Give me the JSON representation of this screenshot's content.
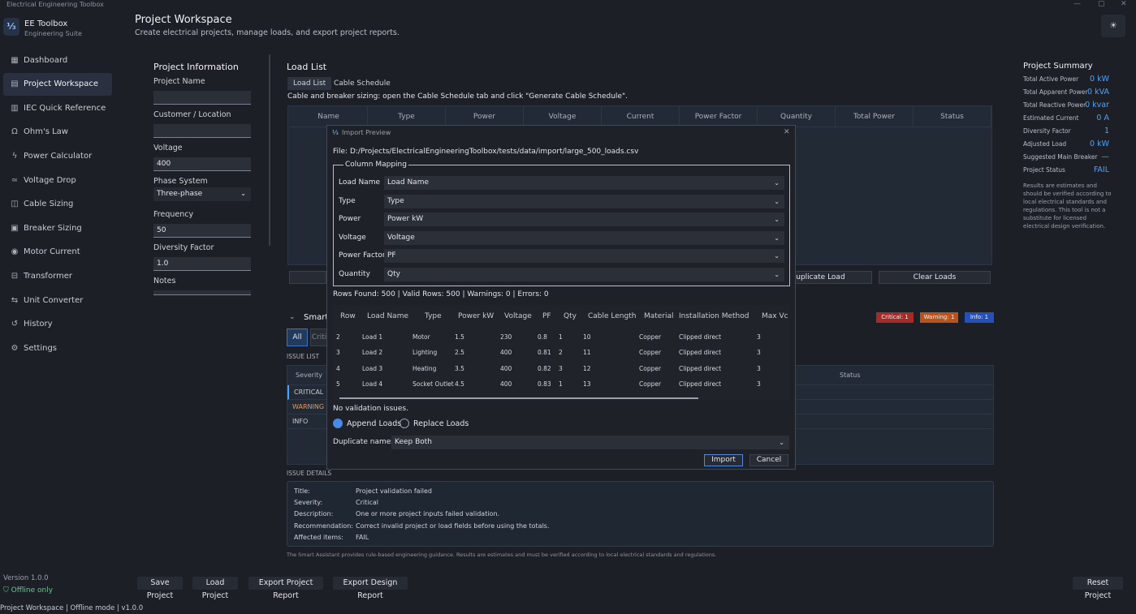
{
  "window": {
    "title": "Electrical Engineering Toolbox"
  },
  "app": {
    "logo": "⅓",
    "name": "EE Toolbox",
    "subtitle": "Engineering Suite",
    "version": "Version 1.0.0",
    "offline": "Offline only"
  },
  "nav": [
    {
      "icon": "dashboard-icon",
      "glyph": "▦",
      "label": "Dashboard"
    },
    {
      "icon": "project-icon",
      "glyph": "▤",
      "label": "Project Workspace",
      "active": true
    },
    {
      "icon": "book-icon",
      "glyph": "▥",
      "label": "IEC Quick Reference"
    },
    {
      "icon": "ohm-icon",
      "glyph": "Ω",
      "label": "Ohm's Law"
    },
    {
      "icon": "bolt-icon",
      "glyph": "ϟ",
      "label": "Power Calculator"
    },
    {
      "icon": "drop-icon",
      "glyph": "≃",
      "label": "Voltage Drop"
    },
    {
      "icon": "cable-icon",
      "glyph": "◫",
      "label": "Cable Sizing"
    },
    {
      "icon": "breaker-icon",
      "glyph": "▣",
      "label": "Breaker Sizing"
    },
    {
      "icon": "motor-icon",
      "glyph": "◉",
      "label": "Motor Current"
    },
    {
      "icon": "transformer-icon",
      "glyph": "⊟",
      "label": "Transformer"
    },
    {
      "icon": "convert-icon",
      "glyph": "⇆",
      "label": "Unit Converter"
    },
    {
      "icon": "history-icon",
      "glyph": "↺",
      "label": "History"
    },
    {
      "icon": "gear-icon",
      "glyph": "⚙",
      "label": "Settings"
    }
  ],
  "header": {
    "title": "Project Workspace",
    "subtitle": "Create electrical projects, manage loads, and export project reports."
  },
  "project_info": {
    "title": "Project Information",
    "fields": [
      {
        "label": "Project Name",
        "value": ""
      },
      {
        "label": "Customer / Location",
        "value": ""
      },
      {
        "label": "Voltage",
        "value": "400"
      },
      {
        "label": "Phase System",
        "value": "Three-phase"
      },
      {
        "label": "Frequency",
        "value": "50"
      },
      {
        "label": "Diversity Factor",
        "value": "1.0"
      },
      {
        "label": "Notes",
        "value": ""
      }
    ]
  },
  "load_list": {
    "title": "Load List",
    "tabs": [
      "Load List",
      "Cable Schedule"
    ],
    "hint": "Cable and breaker sizing: open the Cable Schedule tab and click \"Generate Cable Schedule\".",
    "columns": [
      "Name",
      "Type",
      "Power",
      "Voltage",
      "Current",
      "Power Factor",
      "Quantity",
      "Total Power",
      "Status"
    ],
    "buttons": {
      "duplicate": "Duplicate Load",
      "clear": "Clear Loads"
    }
  },
  "smart": {
    "title": "Smart",
    "filter_all": "All",
    "filter_crit": "Criti",
    "badges": {
      "critical": "Critical: 1",
      "warning": "Warning: 1",
      "info": "Info: 1"
    },
    "issue_list_title": "ISSUE LIST",
    "columns": {
      "severity": "Severity",
      "status": "Status"
    },
    "rows": [
      "CRITICAL",
      "WARNING",
      "INFO"
    ],
    "details_title": "ISSUE DETAILS",
    "details": [
      {
        "label": "Title:",
        "value": "Project validation failed"
      },
      {
        "label": "Severity:",
        "value": "Critical"
      },
      {
        "label": "Description:",
        "value": "One or more project inputs failed validation."
      },
      {
        "label": "Recommendation:",
        "value": "Correct invalid project or load fields before using the totals."
      },
      {
        "label": "Affected items:",
        "value": "FAIL"
      }
    ],
    "disclaimer": "The Smart Assistant provides rule-based engineering guidance. Results are estimates and must be verified according to local electrical standards and regulations."
  },
  "summary": {
    "title": "Project Summary",
    "items": [
      {
        "label": "Total Active Power",
        "value": "0 kW"
      },
      {
        "label": "Total Apparent Power",
        "value": "0 kVA"
      },
      {
        "label": "Total Reactive Power",
        "value": "0 kvar"
      },
      {
        "label": "Estimated Current",
        "value": "0 A"
      },
      {
        "label": "Diversity Factor",
        "value": "1"
      },
      {
        "label": "Adjusted Load",
        "value": "0 kW"
      },
      {
        "label": "Suggested Main Breaker",
        "value": "—"
      },
      {
        "label": "Project Status",
        "value": "FAIL"
      }
    ],
    "note": "Results are estimates and should be verified according to local electrical standards and regulations. This tool is not a substitute for licensed electrical design verification."
  },
  "bottom_buttons": {
    "save": "Save Project",
    "load": "Load Project",
    "export_project": "Export Project Report",
    "export_design": "Export Design Report",
    "reset": "Reset Project"
  },
  "statusbar": "Project Workspace  |  Offline mode  |  v1.0.0",
  "dialog": {
    "title": "Import Preview",
    "file": "File: D:/Projects/ElectricalEngineeringToolbox/tests/data/import/large_500_loads.csv",
    "mapping_title": "Column Mapping",
    "mapping": [
      {
        "label": "Load Name",
        "value": "Load Name"
      },
      {
        "label": "Type",
        "value": "Type"
      },
      {
        "label": "Power",
        "value": "Power kW"
      },
      {
        "label": "Voltage",
        "value": "Voltage"
      },
      {
        "label": "Power Factor",
        "value": "PF"
      },
      {
        "label": "Quantity",
        "value": "Qty"
      }
    ],
    "stats": "Rows Found: 500 | Valid Rows: 500 | Warnings: 0 | Errors: 0",
    "preview_columns": [
      "Row",
      "Load Name",
      "Type",
      "Power kW",
      "Voltage",
      "PF",
      "Qty",
      "Cable Length",
      "Material",
      "Installation Method",
      "Max Vc"
    ],
    "preview_rows": [
      [
        "2",
        "Load 1",
        "Motor",
        "1.5",
        "230",
        "0.8",
        "1",
        "10",
        "Copper",
        "Clipped direct",
        "3"
      ],
      [
        "3",
        "Load 2",
        "Lighting",
        "2.5",
        "400",
        "0.81",
        "2",
        "11",
        "Copper",
        "Clipped direct",
        "3"
      ],
      [
        "4",
        "Load 3",
        "Heating",
        "3.5",
        "400",
        "0.82",
        "3",
        "12",
        "Copper",
        "Clipped direct",
        "3"
      ],
      [
        "5",
        "Load 4",
        "Socket Outlet",
        "4.5",
        "400",
        "0.83",
        "1",
        "13",
        "Copper",
        "Clipped direct",
        "3"
      ]
    ],
    "validation": "No validation issues.",
    "append": "Append Loads",
    "replace": "Replace Loads",
    "dup_label": "Duplicate names:",
    "dup_value": "Keep Both",
    "import": "Import",
    "cancel": "Cancel"
  },
  "colors": {
    "accent": "#4aa3ff",
    "critical": "#a52a2a",
    "warning": "#b8531e",
    "info": "#2450b8"
  }
}
